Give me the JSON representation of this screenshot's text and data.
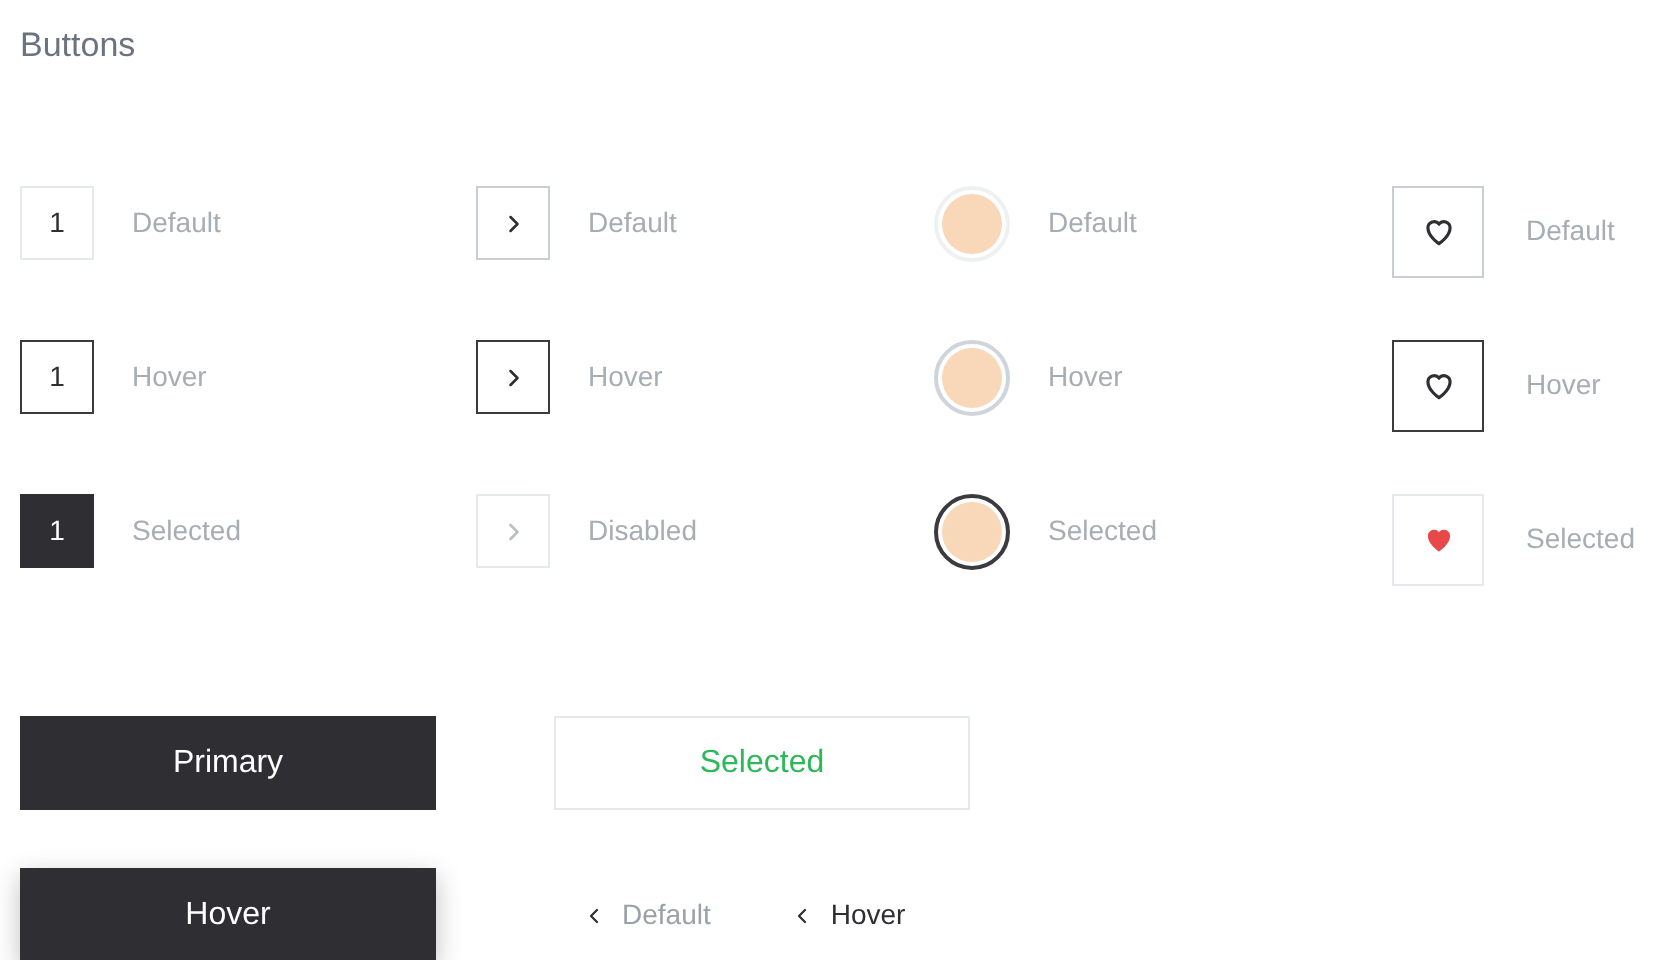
{
  "title": "Buttons",
  "columns": [
    {
      "kind": "page",
      "items": [
        {
          "glyph": "1",
          "label": "Default",
          "hover": false,
          "selected": false
        },
        {
          "glyph": "1",
          "label": "Hover",
          "hover": true,
          "selected": false
        },
        {
          "glyph": "1",
          "label": "Selected",
          "hover": false,
          "selected": true
        }
      ]
    },
    {
      "kind": "arrow",
      "items": [
        {
          "label": "Default",
          "hover": false,
          "disabled": false
        },
        {
          "label": "Hover",
          "hover": true,
          "disabled": false
        },
        {
          "label": "Disabled",
          "hover": false,
          "disabled": true
        }
      ]
    },
    {
      "kind": "swatch",
      "items": [
        {
          "label": "Default",
          "hover": false,
          "selected": false
        },
        {
          "label": "Hover",
          "hover": true,
          "selected": false
        },
        {
          "label": "Selected",
          "hover": false,
          "selected": true
        }
      ]
    },
    {
      "kind": "heart",
      "items": [
        {
          "label": "Default",
          "hover": false,
          "selected": false
        },
        {
          "label": "Hover",
          "hover": true,
          "selected": false
        },
        {
          "label": "Selected",
          "hover": false,
          "selected": true
        }
      ]
    }
  ],
  "buttons": [
    {
      "kind": "primary",
      "label": "Primary",
      "hover": false
    },
    {
      "kind": "outline",
      "label": "Selected",
      "selected": true
    },
    {
      "kind": "primary",
      "label": "Hover",
      "hover": true
    },
    {
      "kind": "back",
      "label": "Default",
      "hover": false
    },
    {
      "kind": "back",
      "label": "Hover",
      "hover": true
    }
  ]
}
